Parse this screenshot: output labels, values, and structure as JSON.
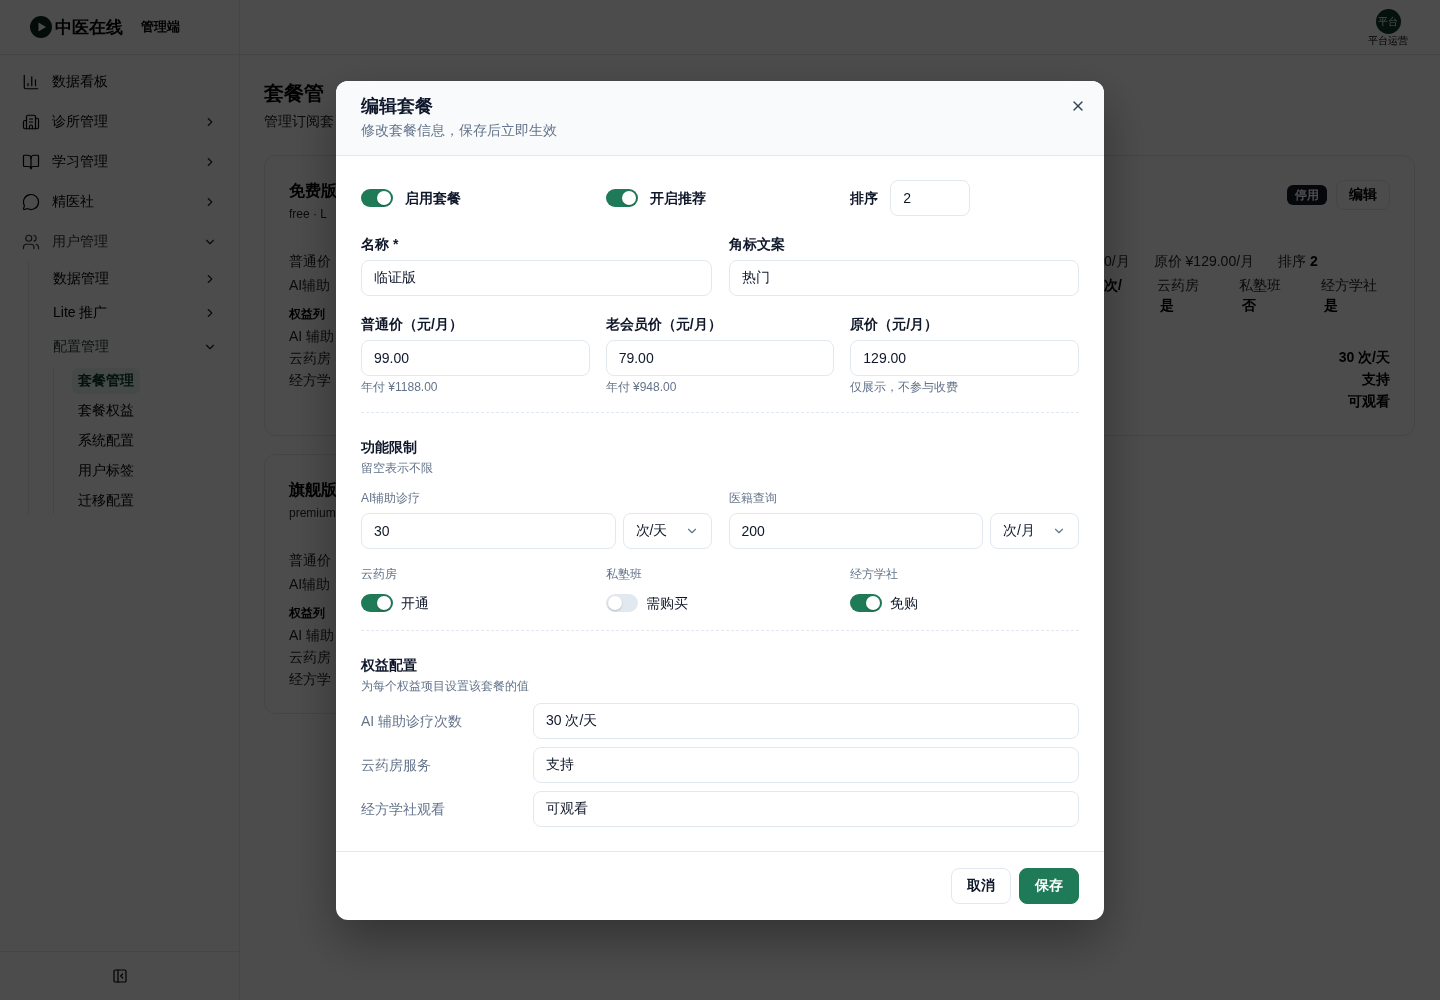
{
  "header": {
    "logo_text": "中医在线",
    "app_label": "管理端",
    "avatar_text": "平台",
    "user_role": "平台运营"
  },
  "sidebar": {
    "items": [
      {
        "kind": "link",
        "label": "数据看板",
        "selected": false
      },
      {
        "kind": "group",
        "label": "诊所管理",
        "expanded": false,
        "selected": false
      },
      {
        "kind": "group",
        "label": "学习管理",
        "expanded": false,
        "selected": false
      },
      {
        "kind": "group",
        "label": "精医社",
        "expanded": false,
        "selected": false
      },
      {
        "kind": "group",
        "label": "用户管理",
        "expanded": true,
        "selected": false,
        "children": [
          {
            "kind": "group",
            "label": "数据管理",
            "expanded": false,
            "selected": false
          },
          {
            "kind": "group",
            "label": "Lite 推广",
            "expanded": false,
            "selected": false
          },
          {
            "kind": "group",
            "label": "配置管理",
            "expanded": true,
            "selected": false,
            "children": [
              {
                "kind": "link",
                "label": "套餐管理",
                "selected": true
              },
              {
                "kind": "link",
                "label": "套餐权益",
                "selected": false
              },
              {
                "kind": "link",
                "label": "系统配置",
                "selected": false
              },
              {
                "kind": "link",
                "label": "用户标签",
                "selected": false
              },
              {
                "kind": "link",
                "label": "迁移配置",
                "selected": false
              }
            ]
          }
        ]
      }
    ]
  },
  "page": {
    "title": "套餐管",
    "subtitle": "管理订阅套"
  },
  "plan_cards": [
    {
      "name": "免费版",
      "meta": "free · L",
      "info_labels": [
        "普通价",
        "AI辅助"
      ],
      "benefits_heading": "权益列",
      "benefit_labels": [
        "AI 辅助",
        "云药房",
        "经方学"
      ],
      "status": "停用",
      "edit_label": "编辑",
      "price_items": [
        "0/月",
        "原价 ¥129.00/月",
        "排序 **2**"
      ],
      "limit_tail": "次/",
      "features": [
        {
          "label": "云药房",
          "value": "是"
        },
        {
          "label": "私塾班",
          "value": "否"
        },
        {
          "label": "经方学社",
          "value": "是"
        }
      ],
      "benefit_values": [
        "30 次/天",
        "支持",
        "可观看"
      ]
    },
    {
      "name": "旗舰版",
      "meta": "premium",
      "info_labels": [
        "普通价",
        "AI辅助"
      ],
      "benefits_heading": "权益列",
      "benefit_labels": [
        "AI 辅助",
        "云药房",
        "经方学"
      ]
    }
  ],
  "dialog": {
    "title": "编辑套餐",
    "subtitle": "修改套餐信息，保存后立即生效",
    "switches": [
      {
        "label": "启用套餐",
        "on": true
      },
      {
        "label": "开启推荐",
        "on": true
      }
    ],
    "sort": {
      "label": "排序",
      "value": "2"
    },
    "text_fields": [
      {
        "label": "名称 *",
        "value": "临证版"
      },
      {
        "label": "角标文案",
        "value": "热门"
      }
    ],
    "price_fields": [
      {
        "label": "普通价（元/月）",
        "value": "99.00",
        "hint": "年付 ¥1188.00"
      },
      {
        "label": "老会员价（元/月）",
        "value": "79.00",
        "hint": "年付 ¥948.00"
      },
      {
        "label": "原价（元/月）",
        "value": "129.00",
        "hint": "仅展示，不参与收费"
      }
    ],
    "limits": {
      "title": "功能限制",
      "hint": "留空表示不限",
      "quotas": [
        {
          "label": "AI辅助诊疗",
          "value": "30",
          "unit": "次/天"
        },
        {
          "label": "医籍查询",
          "value": "200",
          "unit": "次/月"
        }
      ],
      "features": [
        {
          "label": "云药房",
          "on": true,
          "state_text": "开通"
        },
        {
          "label": "私塾班",
          "on": false,
          "state_text": "需购买"
        },
        {
          "label": "经方学社",
          "on": true,
          "state_text": "免购"
        }
      ]
    },
    "benefits": {
      "title": "权益配置",
      "hint": "为每个权益项目设置该套餐的值",
      "rows": [
        {
          "label": "AI 辅助诊疗次数",
          "value": "30 次/天"
        },
        {
          "label": "云药房服务",
          "value": "支持"
        },
        {
          "label": "经方学社观看",
          "value": "可观看"
        }
      ]
    },
    "buttons": [
      {
        "label": "取消",
        "kind": "secondary"
      },
      {
        "label": "保存",
        "kind": "primary"
      }
    ]
  }
}
